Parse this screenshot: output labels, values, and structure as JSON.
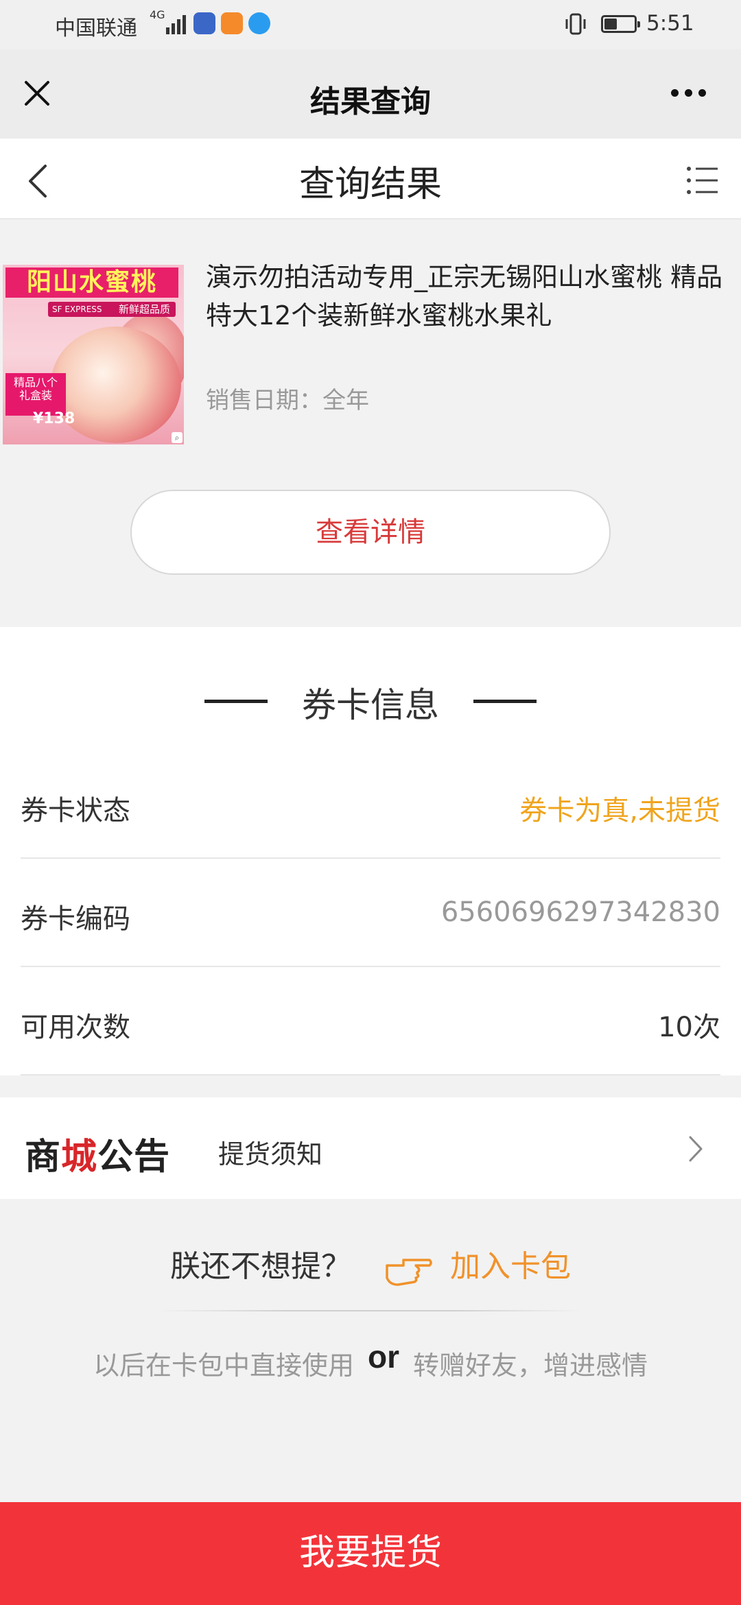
{
  "status_bar": {
    "carrier": "中国联通",
    "network": "4G",
    "time": "5:51",
    "icons": [
      "signal-icon",
      "tieba-app-icon",
      "video-app-icon",
      "browser-app-icon",
      "vibrate-icon",
      "battery-icon"
    ]
  },
  "top_nav": {
    "title": "结果查询",
    "close_icon": "close-icon",
    "more_icon": "more-icon"
  },
  "page_header": {
    "title": "查询结果",
    "back_icon": "chevron-left-icon",
    "menu_icon": "list-icon"
  },
  "product": {
    "image": {
      "banner": "阳山水蜜桃",
      "tag": "新鲜超品质",
      "express": "SF EXPRESS",
      "badge_line1": "精品八个",
      "badge_line2": "礼盒装",
      "price": "¥138"
    },
    "name": "演示勿拍活动专用_正宗无锡阳山水蜜桃 精品特大12个装新鲜水蜜桃水果礼",
    "sale_date": "销售日期：全年",
    "detail_button": "查看详情"
  },
  "card_info": {
    "section_title": "券卡信息",
    "rows": [
      {
        "label": "券卡状态",
        "value": "券卡为真,未提货"
      },
      {
        "label": "券卡编码",
        "value": "6560696297342830"
      },
      {
        "label": "可用次数",
        "value": "10次"
      }
    ]
  },
  "notice": {
    "logo_text_1": "商",
    "logo_text_2": "城",
    "logo_text_3": "公告",
    "label": "提货须知"
  },
  "wallet": {
    "question": "朕还不想提？",
    "link": "加入卡包",
    "hint_before": "以后在卡包中直接使用",
    "or": "or",
    "hint_after": "转赠好友，增进感情"
  },
  "colors": {
    "accent_red": "#f2343a",
    "status_yellow": "#f0a41e",
    "wallet_orange": "#f0922b",
    "detail_red": "#d83a3a"
  },
  "bottom_button": "我要提货"
}
